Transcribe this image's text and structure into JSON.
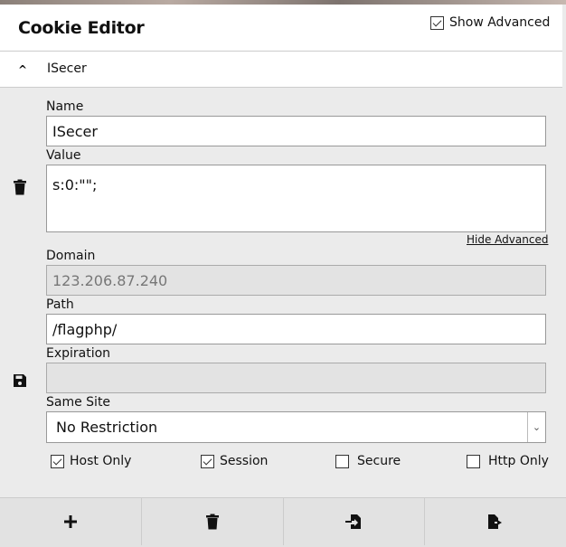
{
  "header": {
    "title": "Cookie Editor",
    "show_advanced_label": "Show Advanced",
    "show_advanced_checked": true
  },
  "cookie": {
    "name_header": "ISecer",
    "expanded": true
  },
  "form": {
    "name_label": "Name",
    "name_value": "ISecer",
    "value_label": "Value",
    "value_value": "s:0:\"\";",
    "hide_advanced": "Hide Advanced",
    "domain_label": "Domain",
    "domain_value": "123.206.87.240",
    "path_label": "Path",
    "path_value": "/flagphp/",
    "expiration_label": "Expiration",
    "expiration_value": "",
    "samesite_label": "Same Site",
    "samesite_value": "No Restriction",
    "flags": [
      {
        "label": "Host Only",
        "checked": true
      },
      {
        "label": "Session",
        "checked": true
      },
      {
        "label": "Secure",
        "checked": false
      },
      {
        "label": "Http Only",
        "checked": false
      }
    ]
  },
  "footer": {
    "buttons": [
      "plus-icon",
      "trash-icon",
      "import-icon",
      "export-icon"
    ]
  }
}
